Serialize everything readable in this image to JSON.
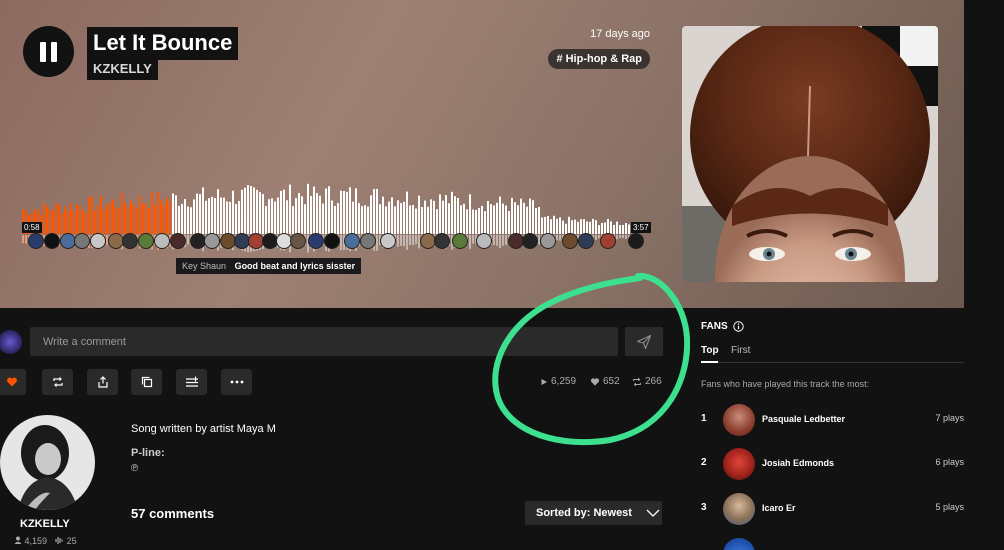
{
  "track": {
    "title": "Let It Bounce",
    "artist": "KZKELLY",
    "posted": "17 days ago",
    "genre": "# Hip-hop & Rap",
    "time_elapsed": "0:58",
    "duration": "3:57",
    "progress": 0.25
  },
  "timed_comment": {
    "user": "Key Shaun",
    "text": "Good beat and lyrics sisster"
  },
  "comment_box": {
    "placeholder": "Write a comment"
  },
  "stats": {
    "plays": "6,259",
    "likes": "652",
    "reposts": "266"
  },
  "actions": [
    "like-icon",
    "repost-icon",
    "share-icon",
    "copy-link-icon",
    "add-to-playlist-icon",
    "more-icon"
  ],
  "artist_card": {
    "name": "KZKELLY",
    "followers": "4,159",
    "tracks": "25"
  },
  "description": {
    "line1": "Song written by artist Maya M",
    "pline_label": "P-line:",
    "pline_symbol": "℗"
  },
  "comments": {
    "count_label": "57 comments",
    "sort_label": "Sorted by: Newest"
  },
  "fans": {
    "title": "FANS",
    "tab_top": "Top",
    "tab_first": "First",
    "subtitle": "Fans who have played this track the most:",
    "list": [
      {
        "rank": "1",
        "name": "Pasquale Ledbetter",
        "plays": "7 plays"
      },
      {
        "rank": "2",
        "name": "Josiah Edmonds",
        "plays": "6 plays"
      },
      {
        "rank": "3",
        "name": "Icaro Er",
        "plays": "5 plays"
      }
    ]
  },
  "colors": {
    "accent": "#ff5500",
    "annotation": "#3de08f",
    "surface": "#2a2a2a",
    "background": "#121212"
  }
}
